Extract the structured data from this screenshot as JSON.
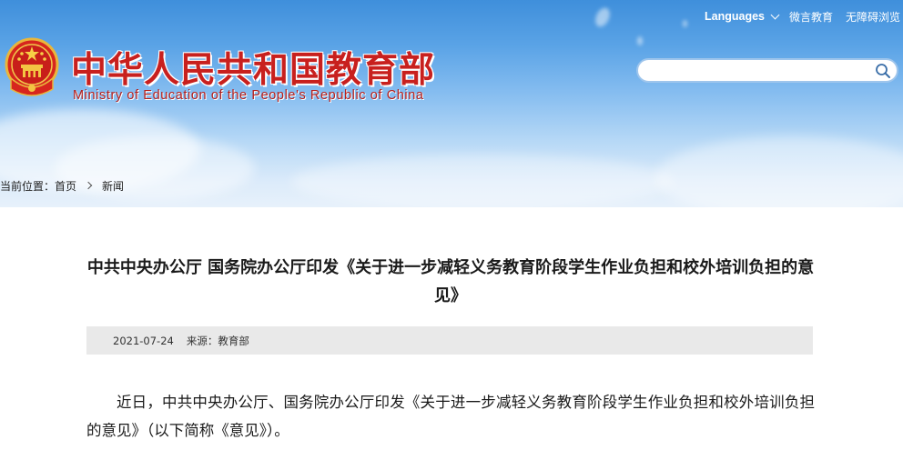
{
  "header": {
    "title_cn": "中华人民共和国教育部",
    "title_en": "Ministry of Education of the People's Republic of China",
    "emblem_icon": "national-emblem-icon",
    "brand_color": "#c8201e"
  },
  "toplinks": {
    "languages": "Languages",
    "weiyan": "微言教育",
    "accessible": "无障碍浏览"
  },
  "search": {
    "placeholder": "",
    "icon": "search-icon"
  },
  "breadcrumb": {
    "label": "当前位置：",
    "home": "首页",
    "current": "新闻"
  },
  "article": {
    "title": "中共中央办公厅 国务院办公厅印发《关于进一步减轻义务教育阶段学生作业负担和校外培训负担的意见》",
    "date": "2021-07-24",
    "source_label": "来源：",
    "source": "教育部",
    "paragraph1": "近日，中共中央办公厅、国务院办公厅印发《关于进一步减轻义务教育阶段学生作业负担和校外培训负担的意见》（以下简称《意见》）。"
  }
}
